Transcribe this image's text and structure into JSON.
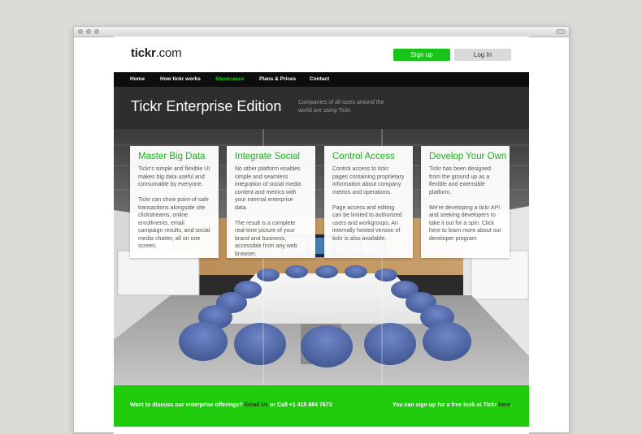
{
  "site": {
    "logo_bold": "tickr",
    "logo_rest": ".com"
  },
  "header": {
    "signup_label": "Sign up",
    "login_label": "Log In"
  },
  "nav": {
    "items": [
      {
        "label": "Home"
      },
      {
        "label": "How tickr works"
      },
      {
        "label": "Showcases",
        "active": true
      },
      {
        "label": "Plans & Prices"
      },
      {
        "label": "Contact"
      }
    ]
  },
  "hero": {
    "title": "Tickr Enterprise Edition",
    "subtitle": "Companies of all sizes around the world are using Tickr."
  },
  "cards": [
    {
      "title": "Master Big Data",
      "body": "Tickr's simple and flexible UI makes big data useful and consumable by everyone.\n\n Tickr can show point-of-sale transactions alongside site clickstreams, online enrollments, email campaign results, and social media chatter, all on one screen."
    },
    {
      "title": "Integrate Social",
      "body": "No other platform enables simple and seamless integration of social media content and metrics with your internal enterprise data.\n\nThe result is a complete real-time picture of your brand and business, accessible from any web browser."
    },
    {
      "title": "Control Access",
      "body": "Control access to tickr pages containing proprietary information about company metrics and operations.\n\nPage access and editing can be limited to authorized users and workgroups. An internally hosted version of tickr is also available."
    },
    {
      "title": "Develop Your Own",
      "body": "Tickr has been designed from the ground up as a flexible and extensible platform.\n\nWe're developing a tickr API and seeking developers to take it out for a spin. Click here to learn more about our developer program"
    }
  ],
  "footer": {
    "left_text": "Want to discuss our enterprise offerings? ",
    "email_link": "Email Us",
    "phone_text": " or Call +1 415 684 7673",
    "right_text": "You can sign up for a free look at Tickr ",
    "here_link": "here",
    "right_end": "."
  },
  "colors": {
    "accent_green": "#1fcc0c",
    "nav_background": "#0d0d0d",
    "page_background": "#dcdcd7"
  }
}
